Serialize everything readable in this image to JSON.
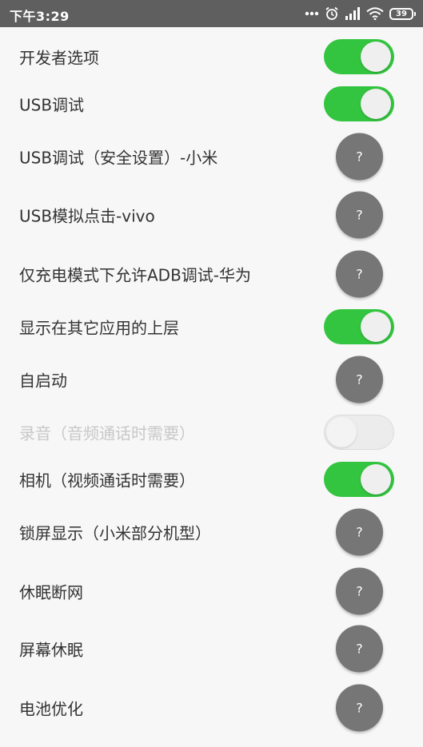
{
  "status_bar": {
    "time": "下午3:29",
    "battery_level": "39",
    "icons": [
      "more-dots-icon",
      "alarm-clock-icon",
      "signal-bars-icon",
      "wifi-icon",
      "battery-icon"
    ]
  },
  "settings": [
    {
      "label": "开发者选项",
      "control": "toggle",
      "state": "on",
      "enabled": true
    },
    {
      "label": "USB调试",
      "control": "toggle",
      "state": "on",
      "enabled": true
    },
    {
      "label": "USB调试（安全设置）-小米",
      "control": "help",
      "button_text": "?"
    },
    {
      "label": "USB模拟点击-vivo",
      "control": "help",
      "button_text": "?"
    },
    {
      "label": "仅充电模式下允许ADB调试-华为",
      "control": "help",
      "button_text": "?"
    },
    {
      "label": "显示在其它应用的上层",
      "control": "toggle",
      "state": "on",
      "enabled": true
    },
    {
      "label": "自启动",
      "control": "help",
      "button_text": "?"
    },
    {
      "label": "录音（音频通话时需要）",
      "control": "toggle",
      "state": "off",
      "enabled": false
    },
    {
      "label": "相机（视频通话时需要）",
      "control": "toggle",
      "state": "on",
      "enabled": true
    },
    {
      "label": "锁屏显示（小米部分机型）",
      "control": "help",
      "button_text": "?"
    },
    {
      "label": "休眠断网",
      "control": "help",
      "button_text": "?"
    },
    {
      "label": "屏幕休眠",
      "control": "help",
      "button_text": "?"
    },
    {
      "label": "电池优化",
      "control": "help",
      "button_text": "?"
    }
  ],
  "colors": {
    "status_bar_bg": "#5f5f5f",
    "toggle_on": "#33c53f",
    "help_button": "#767676",
    "background": "#f7f7f7"
  }
}
